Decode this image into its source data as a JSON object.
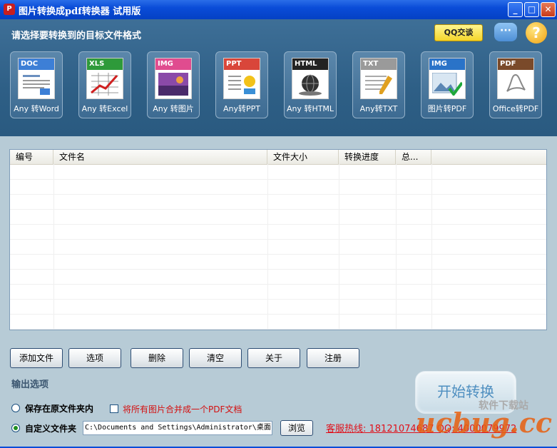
{
  "window": {
    "title": "图片转换成pdf转换器 试用版",
    "app_icon": "pdf-app-icon",
    "controls": [
      "minimize",
      "maximize",
      "close"
    ]
  },
  "header": {
    "heading": "请选择要转换到的目标文件格式",
    "qq_button": "QQ交谈",
    "chat_icon": "chat-bubble-icon",
    "help_icon": "help-icon"
  },
  "tools": [
    {
      "band": "DOC",
      "label": "Any 转Word",
      "color": "#3d7fd6"
    },
    {
      "band": "XLS",
      "label": "Any 转Excel",
      "color": "#2e9a3a"
    },
    {
      "band": "IMG",
      "label": "Any 转图片",
      "color": "#e04c8f"
    },
    {
      "band": "PPT",
      "label": "Any转PPT",
      "color": "#d9463a"
    },
    {
      "band": "HTML",
      "label": "Any 转HTML",
      "color": "#222222"
    },
    {
      "band": "TXT",
      "label": "Any转TXT",
      "color": "#9a9a9a"
    },
    {
      "band": "IMG",
      "label": "图片转PDF",
      "color": "#2a73c8"
    },
    {
      "band": "PDF",
      "label": "Office转PDF",
      "color": "#7a4a2a"
    }
  ],
  "table": {
    "columns": [
      "编号",
      "文件名",
      "文件大小",
      "转换进度",
      "总..."
    ],
    "rows": []
  },
  "buttons": {
    "add_file": "添加文件",
    "options": "选项",
    "delete": "删除",
    "clear": "清空",
    "about": "关于",
    "register": "注册"
  },
  "output": {
    "section_title": "输出选项",
    "radio_original": "保存在原文件夹内",
    "merge_checkbox": "将所有图片合并成一个PDF文档",
    "radio_custom": "自定义文件夹",
    "custom_path": "C:\\Documents and Settings\\Administrator\\桌面",
    "browse": "浏览",
    "selected": "custom",
    "merge_checked": false
  },
  "hotline": "客服热线: 18121074687 QQ: 4000079972",
  "start_button": "开始转换",
  "watermark": {
    "text1": "软件下载站",
    "text2": "ucbug.cc"
  },
  "colors": {
    "titlebar": "#0a4cd8",
    "header": "#2e5f86",
    "accent_red": "#e0101a"
  }
}
